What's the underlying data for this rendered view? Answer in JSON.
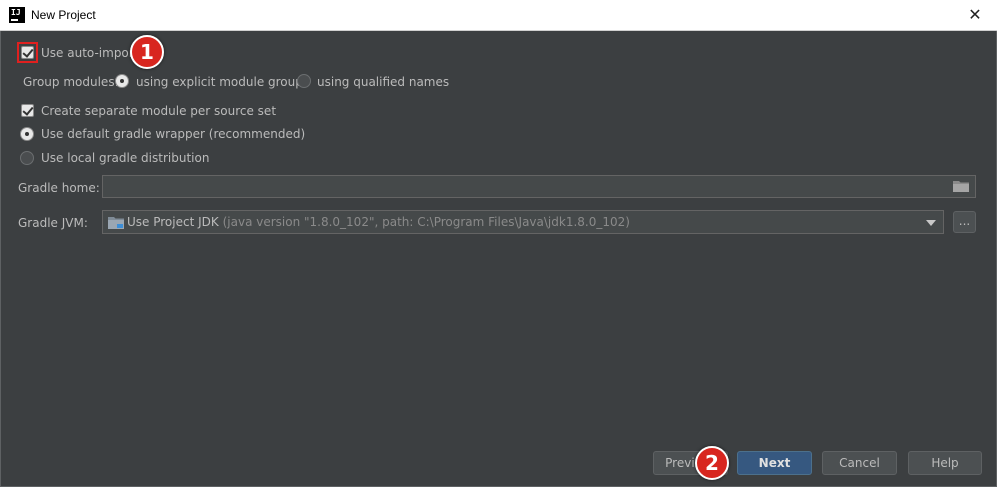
{
  "window": {
    "title": "New Project",
    "app_icon_text": "IJ"
  },
  "options": {
    "auto_import": {
      "label": "Use auto-import",
      "checked": true
    },
    "group_modules": {
      "label": "Group modules:",
      "options": [
        {
          "label": "using explicit module groups",
          "selected": true
        },
        {
          "label": "using qualified names",
          "selected": false
        }
      ]
    },
    "separate_module": {
      "label": "Create separate module per source set",
      "checked": true
    },
    "gradle_source": {
      "options": [
        {
          "label": "Use default gradle wrapper (recommended)",
          "selected": true
        },
        {
          "label": "Use local gradle distribution",
          "selected": false
        }
      ]
    }
  },
  "gradle_home": {
    "label": "Gradle home:",
    "value": ""
  },
  "gradle_jvm": {
    "label": "Gradle JVM:",
    "selected_name": "Use Project JDK",
    "selected_detail": "(java version \"1.8.0_102\", path: C:\\Program Files\\Java\\jdk1.8.0_102)",
    "browse_label": "..."
  },
  "footer": {
    "previous_label": "Previous",
    "next_label": "Next",
    "cancel_label": "Cancel",
    "help_label": "Help"
  },
  "annotations": {
    "badge_1": "1",
    "badge_2": "2"
  },
  "colors": {
    "background": "#3c3f41",
    "accent": "#365880",
    "annotation": "#d8261f"
  }
}
